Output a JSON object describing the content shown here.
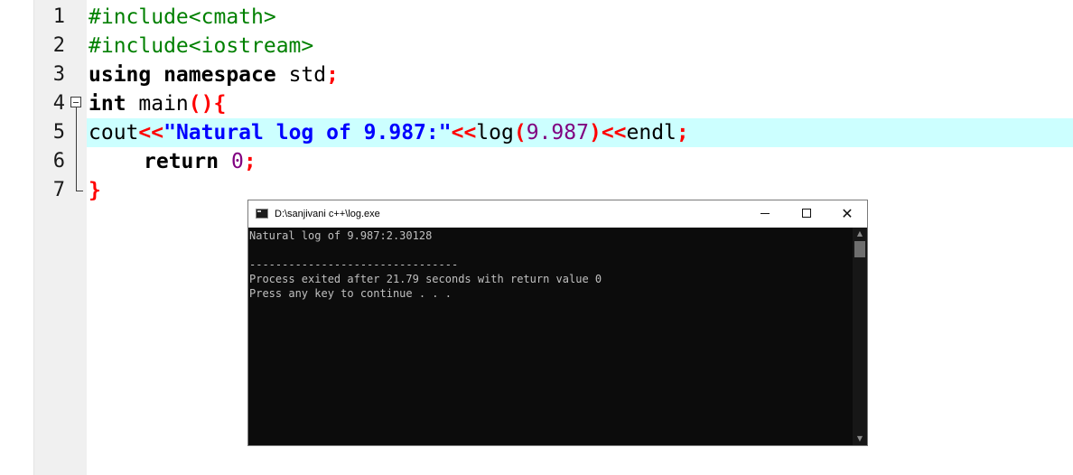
{
  "editor": {
    "line_numbers": [
      "1",
      "2",
      "3",
      "4",
      "5",
      "6",
      "7"
    ],
    "lines": {
      "l1": {
        "a": "#include<cmath>"
      },
      "l2": {
        "a": "#include<iostream>"
      },
      "l3": {
        "a": "using namespace",
        "b": " std",
        "c": ";"
      },
      "l4": {
        "a": "int",
        "b": " main",
        "c": "(){"
      },
      "l5": {
        "a": "cout",
        "b": "<<",
        "c": "\"Natural log of 9.987:\"",
        "d": "<<",
        "e": "log",
        "f": "(",
        "g": "9.987",
        "h": ")",
        "i": "<<",
        "j": "endl",
        "k": ";"
      },
      "l6": {
        "a": "return",
        "b": " ",
        "c": "0",
        "d": ";"
      },
      "l7": {
        "a": "}"
      }
    },
    "highlighted_line": "5",
    "colors": {
      "preprocessor": "#008000",
      "symbol": "#ff0000",
      "string": "#0000ff",
      "number": "#800080",
      "highlight": "#ccffff"
    }
  },
  "console": {
    "title": "D:\\sanjivani c++\\log.exe",
    "controls": {
      "minimize": "minimize",
      "maximize": "maximize",
      "close": "✕"
    },
    "output": [
      "Natural log of 9.987:2.30128",
      "",
      "--------------------------------",
      "Process exited after 21.79 seconds with return value 0",
      "Press any key to continue . . ."
    ],
    "scroll_up_icon": "▲",
    "scroll_down_icon": "▼"
  }
}
